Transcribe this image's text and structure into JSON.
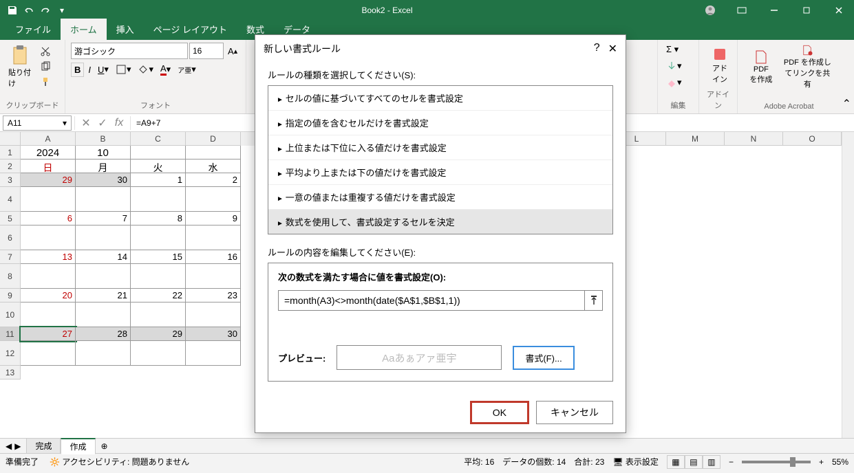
{
  "titlebar": {
    "title": "Book2  -  Excel"
  },
  "tabs": {
    "file": "ファイル",
    "home": "ホーム",
    "insert": "挿入",
    "layout": "ページ レイアウト",
    "formulas": "数式",
    "data": "データ"
  },
  "ribbon": {
    "clipboard": {
      "paste": "貼り付け",
      "group_label": "クリップボード"
    },
    "font": {
      "name": "游ゴシック",
      "size": "16",
      "group_label": "フォント"
    },
    "editing": {
      "group_label": "編集"
    },
    "addins": {
      "label": "アド\nイン",
      "group_label": "アドイン"
    },
    "acrobat": {
      "pdf_create": "PDF\nを作成",
      "pdf_share": "PDF を作成し\nてリンクを共有",
      "group_label": "Adobe Acrobat"
    }
  },
  "formula_bar": {
    "name_box": "A11",
    "formula": "=A9+7"
  },
  "sheet": {
    "cols": [
      "A",
      "B",
      "C",
      "D",
      "L",
      "M",
      "N",
      "O"
    ],
    "rows": [
      "1",
      "2",
      "3",
      "4",
      "5",
      "6",
      "7",
      "8",
      "9",
      "10",
      "11",
      "12",
      "13"
    ],
    "year": "2024",
    "month": "10",
    "day_headers": {
      "sun": "日",
      "mon": "月",
      "tue": "火",
      "wed": "水"
    },
    "calendar": {
      "r3": [
        "29",
        "30",
        "1",
        "2"
      ],
      "r5": [
        "6",
        "7",
        "8",
        "9"
      ],
      "r7": [
        "13",
        "14",
        "15",
        "16"
      ],
      "r9": [
        "20",
        "21",
        "22",
        "23"
      ],
      "r11": [
        "27",
        "28",
        "29",
        "30"
      ]
    }
  },
  "sheet_tabs": {
    "done": "完成",
    "create": "作成"
  },
  "status": {
    "ready": "準備完了",
    "accessibility": "アクセシビリティ: 問題ありません",
    "avg_label": "平均:",
    "avg_val": "16",
    "count_label": "データの個数:",
    "count_val": "14",
    "sum_label": "合計:",
    "sum_val": "23",
    "display": "表示設定",
    "zoom": "55%"
  },
  "dialog": {
    "title": "新しい書式ルール",
    "select_label": "ルールの種類を選択してください(S):",
    "rules": [
      "セルの値に基づいてすべてのセルを書式設定",
      "指定の値を含むセルだけを書式設定",
      "上位または下位に入る値だけを書式設定",
      "平均より上または下の値だけを書式設定",
      "一意の値または重複する値だけを書式設定",
      "数式を使用して、書式設定するセルを決定"
    ],
    "edit_label": "ルールの内容を編集してください(E):",
    "formula_heading": "次の数式を満たす場合に値を書式設定(O):",
    "formula_value": "=month(A3)<>month(date($A$1,$B$1,1))",
    "preview_label": "プレビュー:",
    "preview_placeholder": "Aaあぁアァ亜宇",
    "format_btn": "書式(F)...",
    "ok": "OK",
    "cancel": "キャンセル"
  }
}
